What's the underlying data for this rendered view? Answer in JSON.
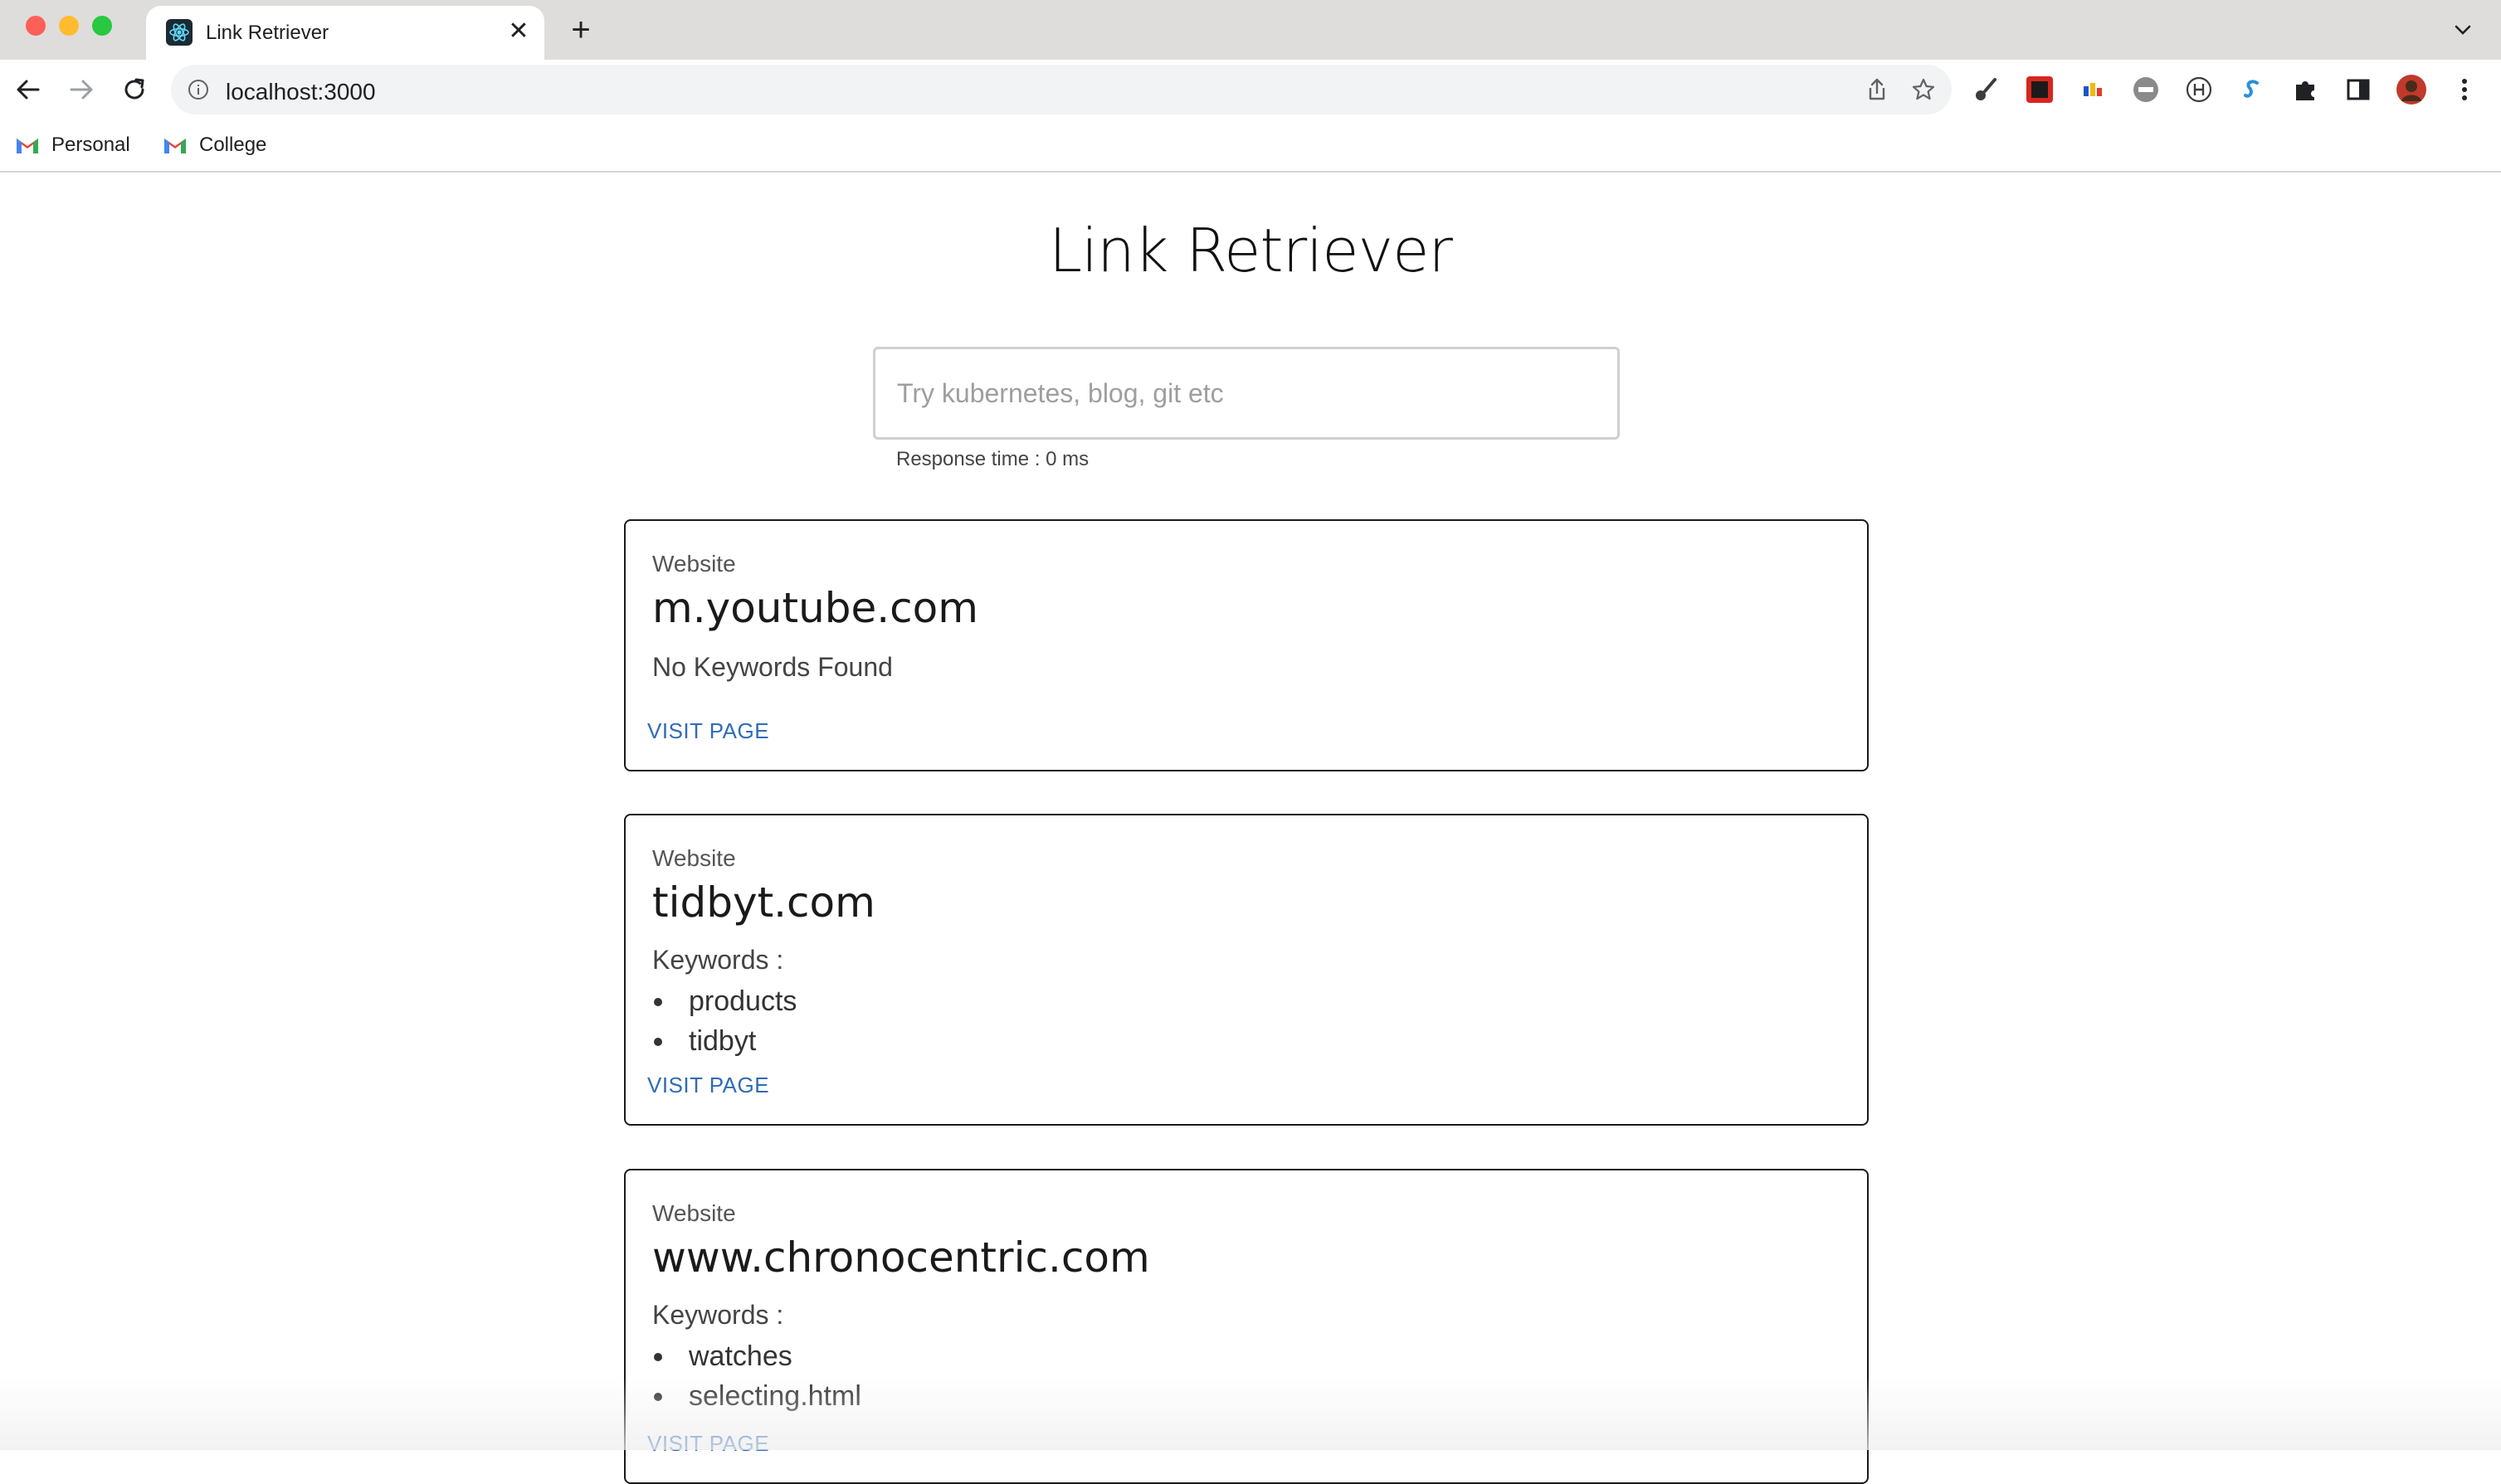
{
  "browser": {
    "tab": {
      "title": "Link Retriever",
      "favicon": "react-atom-icon"
    },
    "address_bar": {
      "url": "localhost:3000"
    },
    "bookmarks": [
      {
        "label": "Personal",
        "icon": "gmail-icon"
      },
      {
        "label": "College",
        "icon": "gmail-icon"
      }
    ],
    "extensions": [
      "paintbrush-icon",
      "adobe-icon",
      "bar-chart-icon",
      "speed-icon",
      "h-circle-icon",
      "s-icon",
      "puzzle-icon",
      "sidebar-icon",
      "avatar"
    ],
    "colors": {
      "traffic_red": "#fe5f57",
      "traffic_yellow": "#febc2e",
      "traffic_green": "#28c840"
    }
  },
  "page": {
    "title": "Link Retriever",
    "search": {
      "placeholder": "Try kubernetes, blog, git etc",
      "value": ""
    },
    "response_time": "Response time : 0 ms",
    "results": [
      {
        "label": "Website",
        "domain": "m.youtube.com",
        "no_keywords_text": "No Keywords Found",
        "visit_label": "VISIT PAGE"
      },
      {
        "label": "Website",
        "domain": "tidbyt.com",
        "keywords_label": "Keywords :",
        "keywords": [
          "products",
          "tidbyt"
        ],
        "visit_label": "VISIT PAGE"
      },
      {
        "label": "Website",
        "domain": "www.chronocentric.com",
        "keywords_label": "Keywords :",
        "keywords": [
          "watches",
          "selecting.html"
        ],
        "visit_label": "VISIT PAGE"
      }
    ],
    "colors": {
      "link": "#2f6bb8",
      "card_border": "#1a1a1a"
    }
  }
}
